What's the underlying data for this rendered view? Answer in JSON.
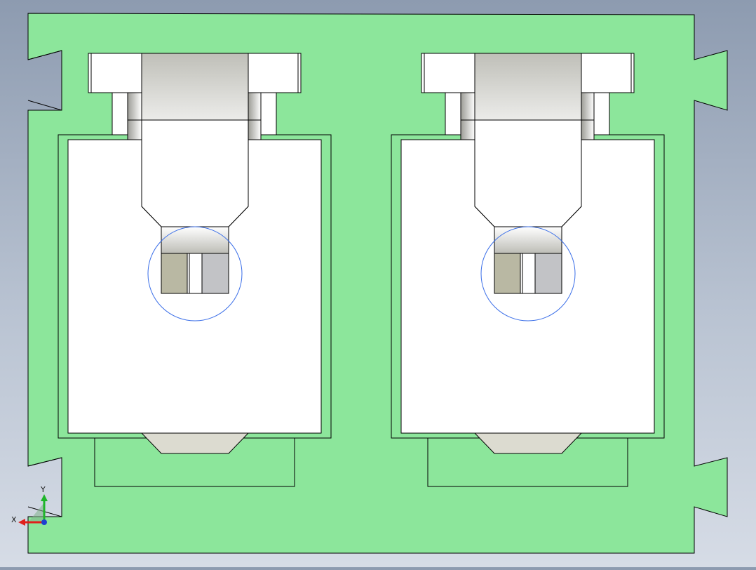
{
  "triad": {
    "x_label": "X",
    "y_label": "Y"
  },
  "colors": {
    "plate_fill": "#8ce69b",
    "outline": "#000000",
    "part_fill": "#ffffff",
    "axis_x": "#e0201c",
    "axis_y": "#1fb52a",
    "axis_z": "#1f3fd0",
    "circle_stroke": "#3a6ee8",
    "block_dark": "#b9b8a3",
    "block_light": "#c2c3c6",
    "bottom_taper": "#dcdbd0"
  }
}
